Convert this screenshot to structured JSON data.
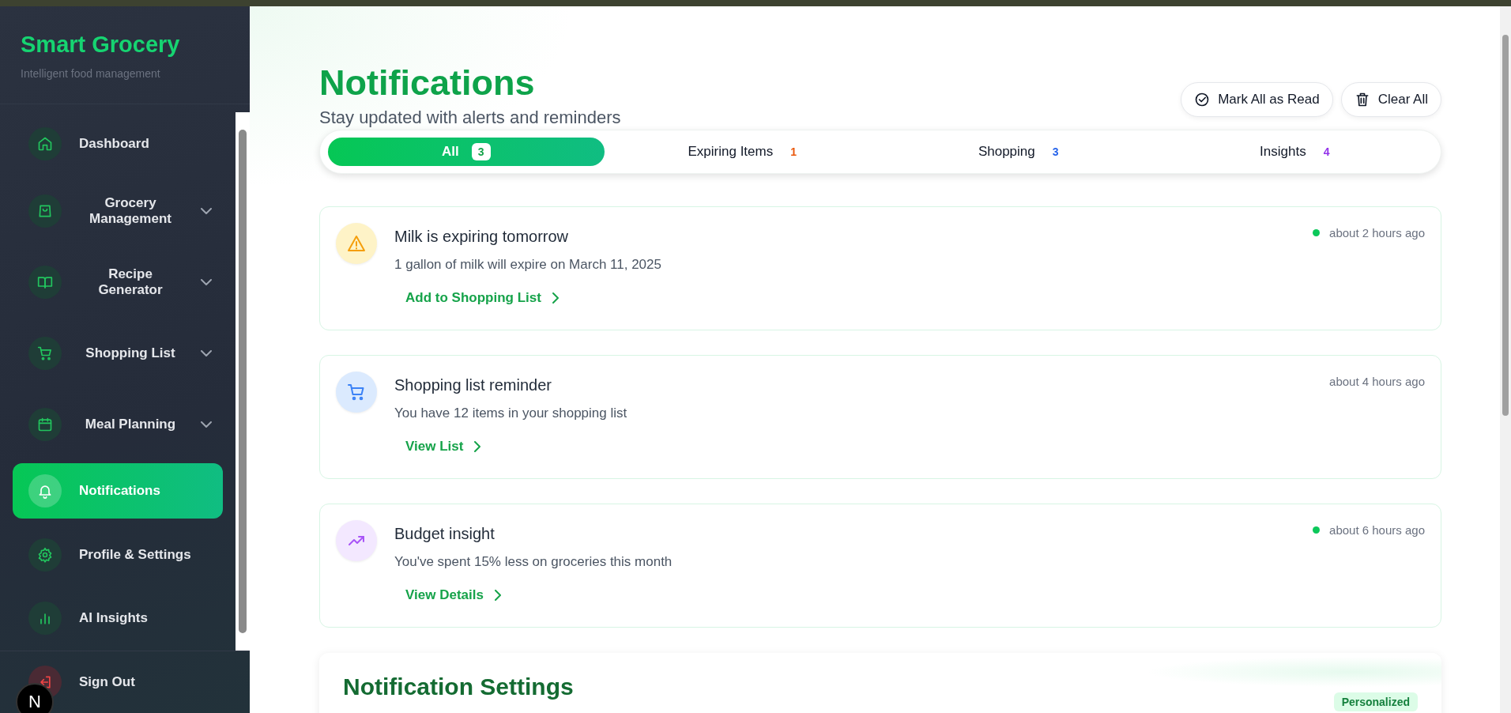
{
  "sidebar": {
    "brand": "Smart Grocery",
    "tagline": "Intelligent food management",
    "items": [
      {
        "label": "Dashboard",
        "expandable": false,
        "selected": false
      },
      {
        "label": "Grocery Management",
        "expandable": true,
        "selected": false
      },
      {
        "label": "Recipe Generator",
        "expandable": true,
        "selected": false
      },
      {
        "label": "Shopping List",
        "expandable": true,
        "selected": false
      },
      {
        "label": "Meal Planning",
        "expandable": true,
        "selected": false
      },
      {
        "label": "Notifications",
        "expandable": false,
        "selected": true
      },
      {
        "label": "Profile & Settings",
        "expandable": false,
        "selected": false
      },
      {
        "label": "AI Insights",
        "expandable": false,
        "selected": false
      }
    ],
    "sign_out": "Sign Out",
    "dev_badge": "N"
  },
  "header": {
    "title": "Notifications",
    "subtitle": "Stay updated with alerts and reminders",
    "buttons": [
      {
        "label": "Mark All as Read"
      },
      {
        "label": "Clear All"
      }
    ]
  },
  "tabs": [
    {
      "label": "All",
      "count": "3",
      "selected": true,
      "color": "#16a34a"
    },
    {
      "label": "Expiring Items",
      "count": "1",
      "selected": false,
      "color": "#ea580c"
    },
    {
      "label": "Shopping",
      "count": "3",
      "selected": false,
      "color": "#2563eb"
    },
    {
      "label": "Insights",
      "count": "4",
      "selected": false,
      "color": "#9333ea"
    }
  ],
  "notifications": [
    {
      "kind": "warning",
      "title": "Milk is expiring tomorrow",
      "message": "1 gallon of milk will expire on March 11, 2025",
      "action": "Add to Shopping List",
      "time": "about 2 hours ago",
      "unread": true
    },
    {
      "kind": "cart",
      "title": "Shopping list reminder",
      "message": "You have 12 items in your shopping list",
      "action": "View List",
      "time": "about 4 hours ago",
      "unread": false
    },
    {
      "kind": "trend",
      "title": "Budget insight",
      "message": "You've spent 15% less on groceries this month",
      "action": "View Details",
      "time": "about 6 hours ago",
      "unread": true
    }
  ],
  "settings": {
    "title": "Notification Settings",
    "badge": "Personalized"
  }
}
